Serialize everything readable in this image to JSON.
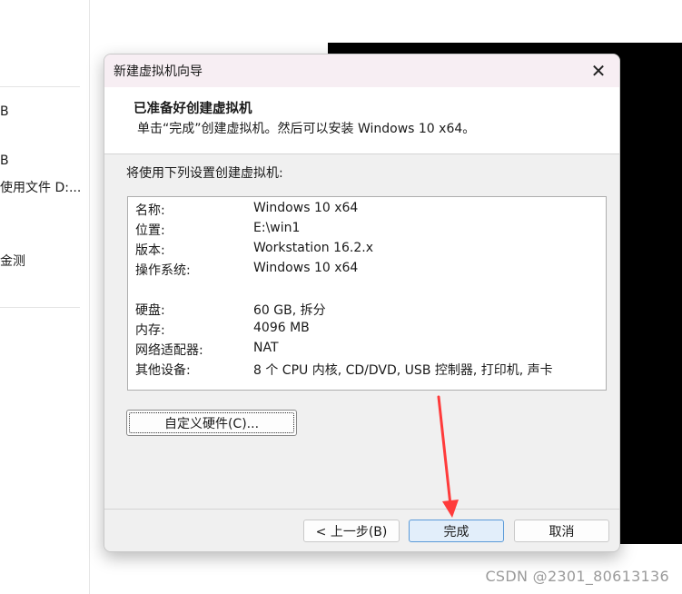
{
  "background": {
    "left_items": [
      "B",
      "B",
      "使用文件 D:...",
      "金测"
    ],
    "watermark": "CSDN @2301_80613136"
  },
  "dialog": {
    "title": "新建虚拟机向导",
    "header_title": "已准备好创建虚拟机",
    "header_subtitle": "单击“完成”创建虚拟机。然后可以安装 Windows 10 x64。",
    "intro": "将使用下列设置创建虚拟机:",
    "settings": [
      {
        "key": "名称:",
        "value": "Windows 10 x64"
      },
      {
        "key": "位置:",
        "value": "E:\\win1"
      },
      {
        "key": "版本:",
        "value": "Workstation 16.2.x"
      },
      {
        "key": "操作系统:",
        "value": "Windows 10 x64"
      },
      {
        "key": "硬盘:",
        "value": "60 GB, 拆分"
      },
      {
        "key": "内存:",
        "value": "4096 MB"
      },
      {
        "key": "网络适配器:",
        "value": "NAT"
      },
      {
        "key": "其他设备:",
        "value": "8 个 CPU 内核, CD/DVD, USB 控制器, 打印机, 声卡"
      }
    ],
    "buttons": {
      "customize_hardware": "自定义硬件(C)...",
      "back": "< 上一步(B)",
      "finish": "完成",
      "cancel": "取消"
    }
  },
  "colors": {
    "titlebar": "#f7eef3",
    "finish_button_border": "#5a9ad8",
    "annotation_arrow": "#ff3b3b"
  },
  "icons": {
    "close": "close-icon"
  }
}
